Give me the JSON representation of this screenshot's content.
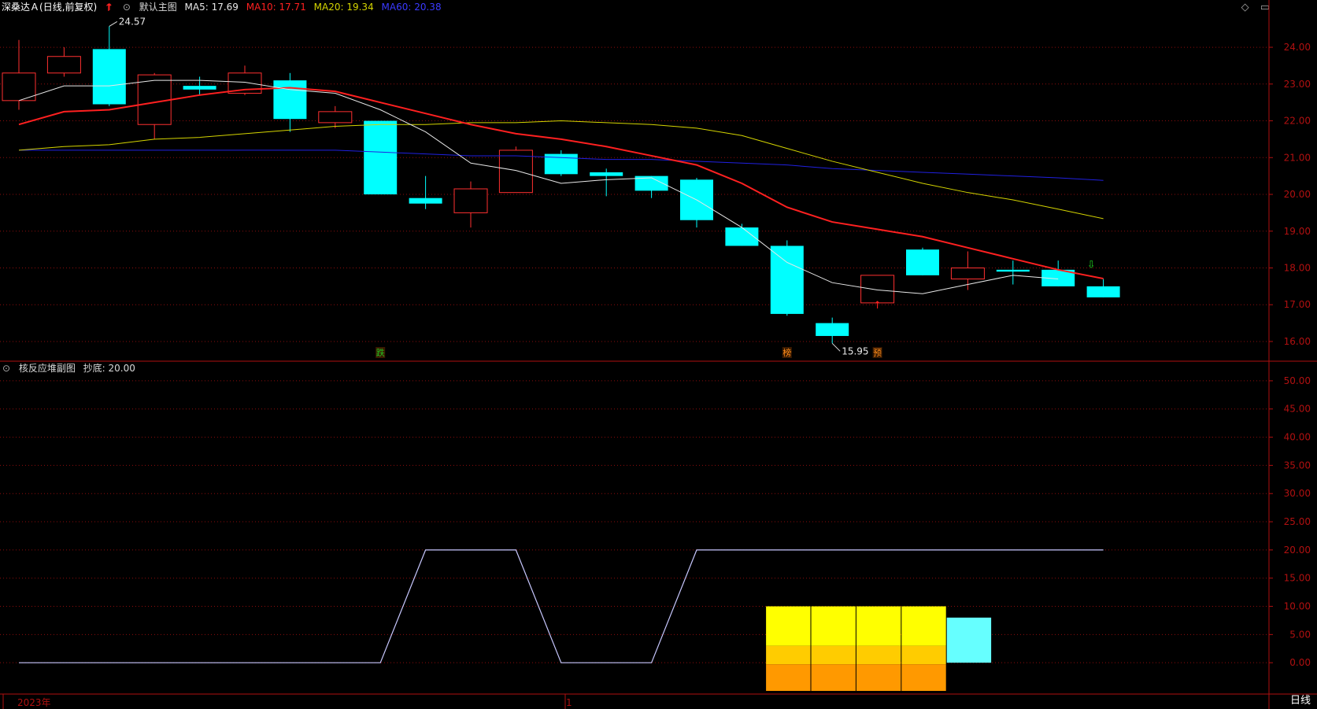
{
  "header": {
    "stock_name": "深桑达Ａ",
    "period": "(日线,前复权)",
    "arrow_icon": "up-arrow-red",
    "menu_icon": "dropdown-icon",
    "main_chart_label": "默认主图",
    "ma5": "MA5: 17.69",
    "ma10": "MA10: 17.71",
    "ma20": "MA20: 19.34",
    "ma60": "MA60: 20.38"
  },
  "sub_header": {
    "indicator_name": "核反应堆副图",
    "value": "抄底: 20.00"
  },
  "colors": {
    "ma5": "#e8e8e8",
    "ma10": "#ff2020",
    "ma20": "#d4d400",
    "ma60": "#2020e0",
    "up": "#ff3030",
    "down": "#00ffff",
    "axis": "#b01010"
  },
  "axis_bottom": {
    "year_label": "2023年",
    "marker_label": "1"
  },
  "period_button": "日线",
  "chart_data": [
    {
      "type": "candlestick",
      "y_ticks": [
        "24.00",
        "23.00",
        "22.00",
        "21.00",
        "20.00",
        "19.00",
        "18.00",
        "17.00",
        "16.00"
      ],
      "ylim": [
        15.55,
        24.9
      ],
      "candles": [
        {
          "o": 22.55,
          "h": 24.2,
          "l": 22.3,
          "c": 23.3
        },
        {
          "o": 23.3,
          "h": 24.0,
          "l": 23.2,
          "c": 23.75
        },
        {
          "o": 23.95,
          "h": 24.57,
          "l": 22.4,
          "c": 22.45
        },
        {
          "o": 21.9,
          "h": 23.3,
          "l": 21.5,
          "c": 23.25
        },
        {
          "o": 22.95,
          "h": 23.2,
          "l": 22.7,
          "c": 22.85
        },
        {
          "o": 22.75,
          "h": 23.5,
          "l": 22.7,
          "c": 23.3
        },
        {
          "o": 23.1,
          "h": 23.3,
          "l": 21.7,
          "c": 22.05
        },
        {
          "o": 21.95,
          "h": 22.4,
          "l": 21.8,
          "c": 22.25
        },
        {
          "o": 22.0,
          "h": 22.0,
          "l": 20.0,
          "c": 20.0
        },
        {
          "o": 19.9,
          "h": 20.5,
          "l": 19.6,
          "c": 19.75
        },
        {
          "o": 19.5,
          "h": 20.35,
          "l": 19.1,
          "c": 20.15
        },
        {
          "o": 20.05,
          "h": 21.3,
          "l": 20.05,
          "c": 21.2
        },
        {
          "o": 21.1,
          "h": 21.2,
          "l": 20.5,
          "c": 20.55
        },
        {
          "o": 20.6,
          "h": 20.7,
          "l": 19.95,
          "c": 20.5
        },
        {
          "o": 20.5,
          "h": 20.5,
          "l": 19.9,
          "c": 20.1
        },
        {
          "o": 20.4,
          "h": 20.45,
          "l": 19.1,
          "c": 19.3
        },
        {
          "o": 19.1,
          "h": 19.2,
          "l": 18.6,
          "c": 18.6
        },
        {
          "o": 18.6,
          "h": 18.75,
          "l": 16.7,
          "c": 16.75
        },
        {
          "o": 16.5,
          "h": 16.65,
          "l": 15.95,
          "c": 16.15
        },
        {
          "o": 17.05,
          "h": 17.8,
          "l": 17.05,
          "c": 17.8
        },
        {
          "o": 18.5,
          "h": 18.55,
          "l": 17.8,
          "c": 17.8
        },
        {
          "o": 17.7,
          "h": 18.45,
          "l": 17.4,
          "c": 18.0
        },
        {
          "o": 17.95,
          "h": 18.2,
          "l": 17.55,
          "c": 17.9
        },
        {
          "o": 17.95,
          "h": 18.2,
          "l": 17.5,
          "c": 17.5
        },
        {
          "o": 17.5,
          "h": 17.7,
          "l": 17.2,
          "c": 17.2
        }
      ],
      "ma_lines": {
        "ma5": [
          22.55,
          22.95,
          22.95,
          23.1,
          23.1,
          23.05,
          22.85,
          22.75,
          22.3,
          21.7,
          20.85,
          20.65,
          20.3,
          20.4,
          20.45,
          19.85,
          19.1,
          18.15,
          17.6,
          17.4,
          17.3,
          17.55,
          17.8,
          17.7
        ],
        "ma10": [
          21.9,
          22.25,
          22.3,
          22.5,
          22.7,
          22.85,
          22.9,
          22.8,
          22.5,
          22.2,
          21.9,
          21.65,
          21.5,
          21.3,
          21.05,
          20.8,
          20.3,
          19.65,
          19.25,
          19.05,
          18.85,
          18.55,
          18.25,
          17.95,
          17.71
        ],
        "ma20": [
          21.2,
          21.3,
          21.35,
          21.5,
          21.55,
          21.65,
          21.75,
          21.85,
          21.9,
          21.9,
          21.95,
          21.95,
          22.0,
          21.95,
          21.9,
          21.8,
          21.6,
          21.25,
          20.9,
          20.6,
          20.3,
          20.05,
          19.85,
          19.6,
          19.34
        ],
        "ma60": [
          21.2,
          21.2,
          21.2,
          21.2,
          21.2,
          21.2,
          21.2,
          21.2,
          21.15,
          21.1,
          21.05,
          21.05,
          21.0,
          20.95,
          20.95,
          20.9,
          20.85,
          20.8,
          20.7,
          20.65,
          20.6,
          20.55,
          20.5,
          20.45,
          20.38
        ]
      },
      "annotations": [
        {
          "label": "24.57",
          "index": 2,
          "value": 24.57
        },
        {
          "label": "15.95",
          "index": 18,
          "value": 15.95
        }
      ],
      "signals": [
        {
          "label": "跌",
          "index": 8
        },
        {
          "label": "榜",
          "index": 17
        },
        {
          "label": "预",
          "index": 19
        }
      ]
    },
    {
      "type": "line",
      "y_ticks": [
        "50.00",
        "45.00",
        "40.00",
        "35.00",
        "30.00",
        "25.00",
        "20.00",
        "15.00",
        "10.00",
        "5.00",
        "0.00"
      ],
      "ylim": [
        -5,
        52.5
      ],
      "line_values": [
        0,
        0,
        0,
        0,
        0,
        0,
        0,
        0,
        0,
        20,
        20,
        20,
        0,
        0,
        0,
        20,
        20,
        20,
        20,
        20,
        20,
        20,
        20,
        20,
        20
      ],
      "bars": [
        {
          "index": 17,
          "value": 10,
          "color": "yellow"
        },
        {
          "index": 18,
          "value": 10,
          "color": "yellow"
        },
        {
          "index": 19,
          "value": 10,
          "color": "yellow"
        },
        {
          "index": 20,
          "value": 10,
          "color": "yellow"
        },
        {
          "index": 21,
          "value": 8,
          "color": "cyan"
        }
      ]
    }
  ]
}
